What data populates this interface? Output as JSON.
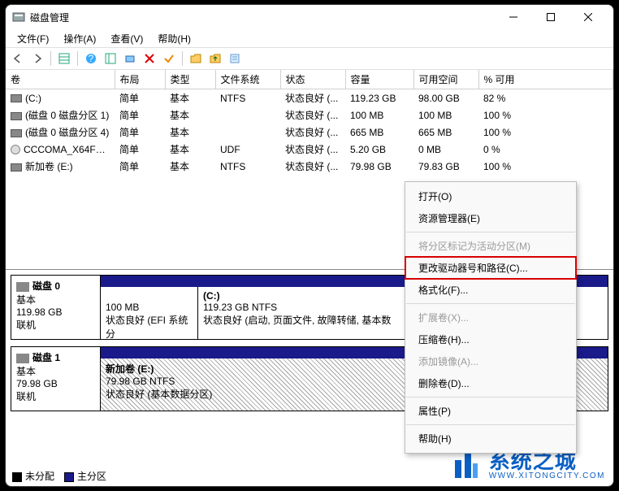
{
  "window": {
    "title": "磁盘管理"
  },
  "menu": {
    "file": "文件(F)",
    "action": "操作(A)",
    "view": "查看(V)",
    "help": "帮助(H)"
  },
  "columns": {
    "volume": "卷",
    "layout": "布局",
    "type": "类型",
    "fs": "文件系统",
    "status": "状态",
    "capacity": "容量",
    "free": "可用空间",
    "pct": "% 可用"
  },
  "rows": [
    {
      "vol": "(C:)",
      "layout": "简单",
      "type": "基本",
      "fs": "NTFS",
      "status": "状态良好 (...",
      "capacity": "119.23 GB",
      "free": "98.00 GB",
      "pct": "82 %",
      "icon": "hdd"
    },
    {
      "vol": "(磁盘 0 磁盘分区 1)",
      "layout": "简单",
      "type": "基本",
      "fs": "",
      "status": "状态良好 (...",
      "capacity": "100 MB",
      "free": "100 MB",
      "pct": "100 %",
      "icon": "hdd"
    },
    {
      "vol": "(磁盘 0 磁盘分区 4)",
      "layout": "简单",
      "type": "基本",
      "fs": "",
      "status": "状态良好 (...",
      "capacity": "665 MB",
      "free": "665 MB",
      "pct": "100 %",
      "icon": "hdd"
    },
    {
      "vol": "CCCOMA_X64FR...",
      "layout": "简单",
      "type": "基本",
      "fs": "UDF",
      "status": "状态良好 (...",
      "capacity": "5.20 GB",
      "free": "0 MB",
      "pct": "0 %",
      "icon": "cd"
    },
    {
      "vol": "新加卷 (E:)",
      "layout": "简单",
      "type": "基本",
      "fs": "NTFS",
      "status": "状态良好 (...",
      "capacity": "79.98 GB",
      "free": "79.83 GB",
      "pct": "100 %",
      "icon": "hdd"
    }
  ],
  "disk0": {
    "name": "磁盘 0",
    "type": "基本",
    "size": "119.98 GB",
    "state": "联机",
    "p1_size": "100 MB",
    "p1_status": "状态良好 (EFI 系统分",
    "p2_name": "(C:)",
    "p2_size": "119.23 GB NTFS",
    "p2_status": "状态良好 (启动, 页面文件, 故障转储, 基本数"
  },
  "disk1": {
    "name": "磁盘 1",
    "type": "基本",
    "size": "79.98 GB",
    "state": "联机",
    "p1_name": "新加卷  (E:)",
    "p1_size": "79.98 GB NTFS",
    "p1_status": "状态良好 (基本数据分区)"
  },
  "legend": {
    "unalloc": "未分配",
    "primary": "主分区"
  },
  "ctx": {
    "open": "打开(O)",
    "explorer": "资源管理器(E)",
    "mark_active": "将分区标记为活动分区(M)",
    "change_letter": "更改驱动器号和路径(C)...",
    "format": "格式化(F)...",
    "extend": "扩展卷(X)...",
    "shrink": "压缩卷(H)...",
    "add_mirror": "添加镜像(A)...",
    "delete": "删除卷(D)...",
    "properties": "属性(P)",
    "help": "帮助(H)"
  },
  "watermark": {
    "name": "系统之城",
    "url": "WWW.XITONGCITY.COM"
  }
}
